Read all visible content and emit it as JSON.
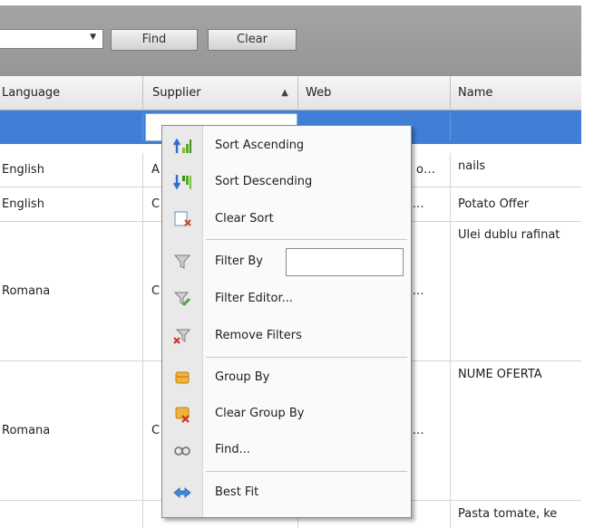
{
  "toolbar": {
    "find_label": "Find",
    "clear_label": "Clear",
    "combo_value": ""
  },
  "grid": {
    "columns": [
      {
        "label": "Language"
      },
      {
        "label": "Supplier"
      },
      {
        "label": "Web"
      },
      {
        "label": "Name"
      }
    ],
    "rows": [
      {
        "language": "English",
        "supplier": "A",
        "web": "o…",
        "name": "nails"
      },
      {
        "language": "English",
        "supplier": "C",
        "web": "m…",
        "name": "Potato Offer"
      },
      {
        "language": "Romana",
        "supplier": "C",
        "web": "m…",
        "name": "Ulei dublu rafinat"
      },
      {
        "language": "Romana",
        "supplier": "C",
        "web": "m…",
        "name": "NUME OFERTA"
      },
      {
        "language": "",
        "supplier": "",
        "web": "",
        "name": "Pasta tomate, ke"
      }
    ]
  },
  "context_menu": {
    "items": [
      {
        "label": "Sort Ascending",
        "icon": "sort-ascending-icon"
      },
      {
        "label": "Sort Descending",
        "icon": "sort-descending-icon"
      },
      {
        "label": "Clear Sort",
        "icon": "clear-sort-icon"
      },
      {
        "label": "Filter By",
        "icon": "filter-icon"
      },
      {
        "label": "Filter Editor...",
        "icon": "filter-editor-icon"
      },
      {
        "label": "Remove Filters",
        "icon": "remove-filters-icon"
      },
      {
        "label": "Group By",
        "icon": "group-by-icon"
      },
      {
        "label": "Clear Group By",
        "icon": "clear-group-icon"
      },
      {
        "label": "Find...",
        "icon": "find-icon"
      },
      {
        "label": "Best Fit",
        "icon": "best-fit-icon"
      }
    ],
    "filter_by_value": ""
  },
  "colors": {
    "toolbar_bg": "#9d9d9d",
    "selection_row": "#3f7fd8",
    "menu_bg": "#fafafa",
    "menu_gutter": "#e9e9e9"
  }
}
